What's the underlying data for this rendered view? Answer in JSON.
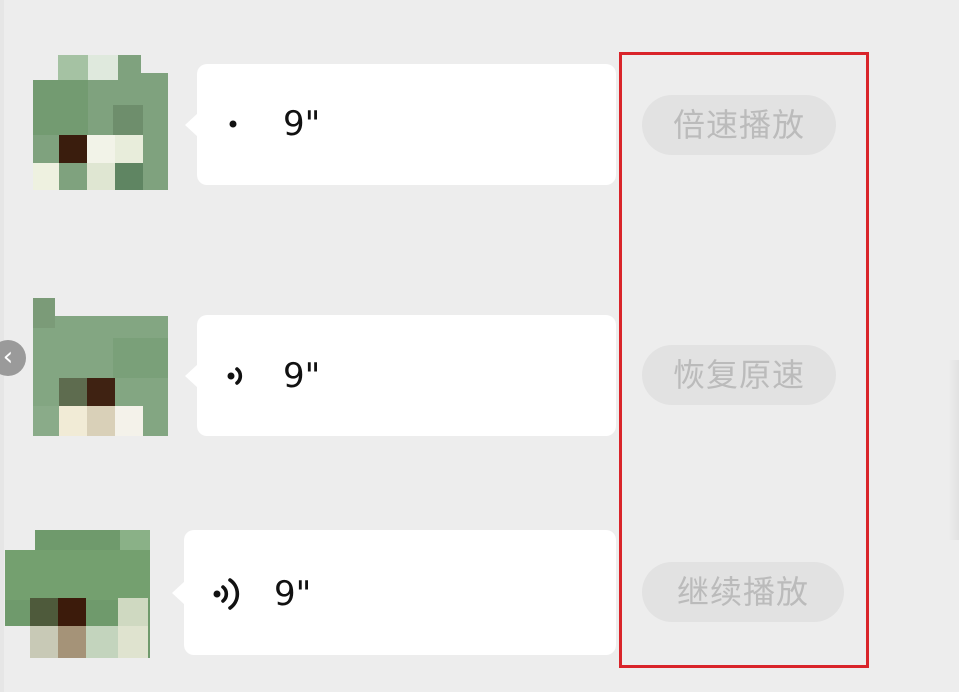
{
  "messages": [
    {
      "duration": "9\"",
      "action_label": "倍速播放"
    },
    {
      "duration": "9\"",
      "action_label": "恢复原速"
    },
    {
      "duration": "9\"",
      "action_label": "继续播放"
    }
  ],
  "icons": {
    "back": "chevron-left-icon",
    "back_glyph": "‹",
    "voice": "voice-wave-icon"
  },
  "colors": {
    "background": "#ededed",
    "bubble": "#ffffff",
    "pill_bg": "#e2e2e2",
    "pill_text": "#bbbbbb",
    "highlight": "#d9242a"
  }
}
